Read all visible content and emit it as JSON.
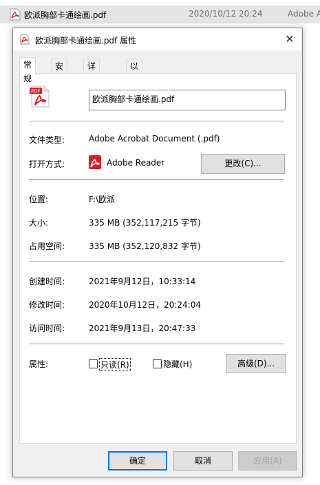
{
  "file_row": {
    "name": "欧派胸部卡通绘画.pdf",
    "date": "2020/10/12 20:24",
    "type": "Adobe A"
  },
  "dialog": {
    "title": "欧派胸部卡通绘画.pdf 属性",
    "tabs": [
      "常规",
      "安全",
      "详细信息",
      "以前的版本"
    ],
    "filename": "欧派胸部卡通绘画.pdf",
    "file_type_label": "文件类型:",
    "file_type_value": "Adobe Acrobat Document (.pdf)",
    "open_with_label": "打开方式:",
    "open_with_value": "Adobe Reader",
    "change_button": "更改(C)...",
    "location_label": "位置:",
    "location_value": "F:\\欧派",
    "size_label": "大小:",
    "size_value": "335 MB (352,117,215 字节)",
    "disk_size_label": "占用空间:",
    "disk_size_value": "335 MB (352,120,832 字节)",
    "created_label": "创建时间:",
    "created_value": "2021年9月12日，10:33:14",
    "modified_label": "修改时间:",
    "modified_value": "2020年10月12日，20:24:04",
    "accessed_label": "访问时间:",
    "accessed_value": "2021年9月13日，20:47:33",
    "attributes_label": "属性:",
    "readonly_label": "只读(R)",
    "hidden_label": "隐藏(H)",
    "advanced_button": "高级(D)...",
    "ok_button": "确定",
    "cancel_button": "取消",
    "apply_button": "应用(A)",
    "pdf_icon_text": "PDF"
  },
  "colors": {
    "accent": "#0078d7",
    "pdf_red": "#d2232a"
  },
  "icons": [
    "pdf-file-icon",
    "close-icon",
    "adobe-reader-icon",
    "checkbox"
  ]
}
